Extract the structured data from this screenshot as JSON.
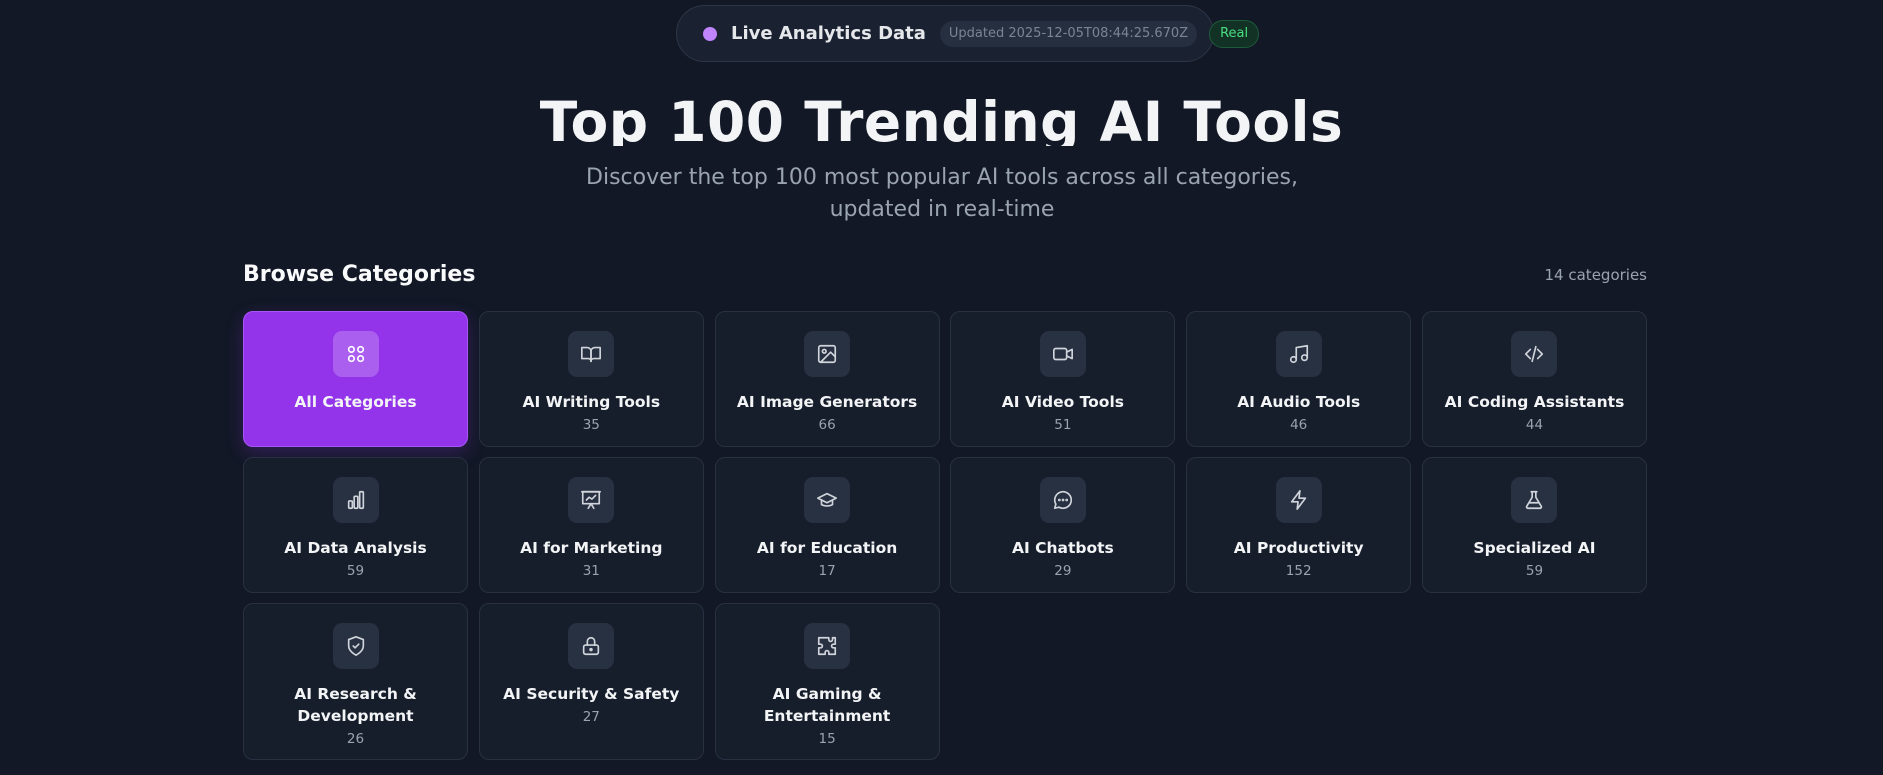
{
  "status": {
    "live_label": "Live Analytics Data",
    "updated": "Updated 2025-12-05T08:44:25.670Z",
    "badge": "Real",
    "dot_color": "#c084fc",
    "badge_color": "#4ade80"
  },
  "hero": {
    "title": "Top 100 Trending AI Tools",
    "subtitle": "Discover the top 100 most popular AI tools across all categories, updated in real-time"
  },
  "browse": {
    "title": "Browse Categories",
    "count": "14 categories"
  },
  "accent_color": "#9333ea",
  "categories": [
    {
      "name": "All Categories",
      "count": "",
      "icon": "grid-icon"
    },
    {
      "name": "AI Writing Tools",
      "count": "35",
      "icon": "book-icon"
    },
    {
      "name": "AI Image Generators",
      "count": "66",
      "icon": "image-icon"
    },
    {
      "name": "AI Video Tools",
      "count": "51",
      "icon": "video-icon"
    },
    {
      "name": "AI Audio Tools",
      "count": "46",
      "icon": "music-icon"
    },
    {
      "name": "AI Coding Assistants",
      "count": "44",
      "icon": "code-icon"
    },
    {
      "name": "AI Data Analysis",
      "count": "59",
      "icon": "bar-chart-icon"
    },
    {
      "name": "AI for Marketing",
      "count": "31",
      "icon": "presentation-icon"
    },
    {
      "name": "AI for Education",
      "count": "17",
      "icon": "graduation-cap-icon"
    },
    {
      "name": "AI Chatbots",
      "count": "29",
      "icon": "chat-bubble-icon"
    },
    {
      "name": "AI Productivity",
      "count": "152",
      "icon": "lightning-icon"
    },
    {
      "name": "Specialized AI",
      "count": "59",
      "icon": "flask-icon"
    },
    {
      "name": "AI Research & Development",
      "count": "26",
      "icon": "shield-check-icon"
    },
    {
      "name": "AI Security & Safety",
      "count": "27",
      "icon": "lock-icon"
    },
    {
      "name": "AI Gaming & Entertainment",
      "count": "15",
      "icon": "puzzle-icon"
    }
  ]
}
